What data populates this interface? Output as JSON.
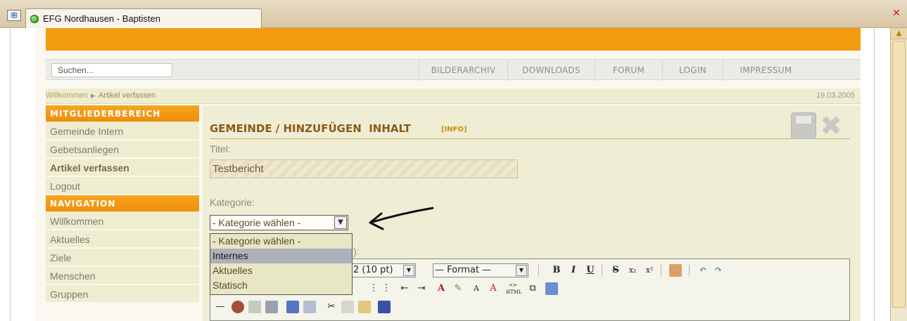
{
  "window": {
    "title": "EFG Nordhausen - Baptisten"
  },
  "header": {
    "search_placeholder": "Suchen...",
    "menu": [
      "BILDERARCHIV",
      "DOWNLOADS",
      "FORUM",
      "LOGIN",
      "IMPRESSUM"
    ]
  },
  "breadcrumb": {
    "home": "Willkommen",
    "current": "Artikel verfassen",
    "date": "19.03.2005"
  },
  "sidebar": {
    "members_header": "MITGLIEDERBEREICH",
    "members_items": [
      "Gemeinde Intern",
      "Gebetsanliegen",
      "Artikel verfassen",
      "Logout"
    ],
    "nav_header": "NAVIGATION",
    "nav_items": [
      "Willkommen",
      "Aktuelles",
      "Ziele",
      "Menschen",
      "Gruppen"
    ]
  },
  "content": {
    "title": "GEMEINDE / HINZUFÜGEN  INHALT",
    "info": "[INFO]",
    "titel_label": "Titel:",
    "titel_value": "Testbericht",
    "kategorie_label": "Kategorie:",
    "kategorie_selected": "- Kategorie wählen -",
    "kategorie_options": [
      "- Kategorie wählen -",
      "Internes",
      "Aktuelles",
      "Statisch"
    ],
    "hidden_label_fragment": "):",
    "editor": {
      "font_size": "2 (10 pt)",
      "format": "— Format —",
      "bold": "B",
      "italic": "I",
      "underline": "U",
      "strike": "S",
      "subscript": "x₂",
      "superscript": "x²",
      "text_small": "A",
      "text_big": "A",
      "html_label": "HTML"
    }
  },
  "colors": {
    "orange": "#f39c12",
    "sidebar_bg": "#efedcf",
    "content_bg": "#efeed5",
    "title_brown": "#8a5a1c"
  }
}
